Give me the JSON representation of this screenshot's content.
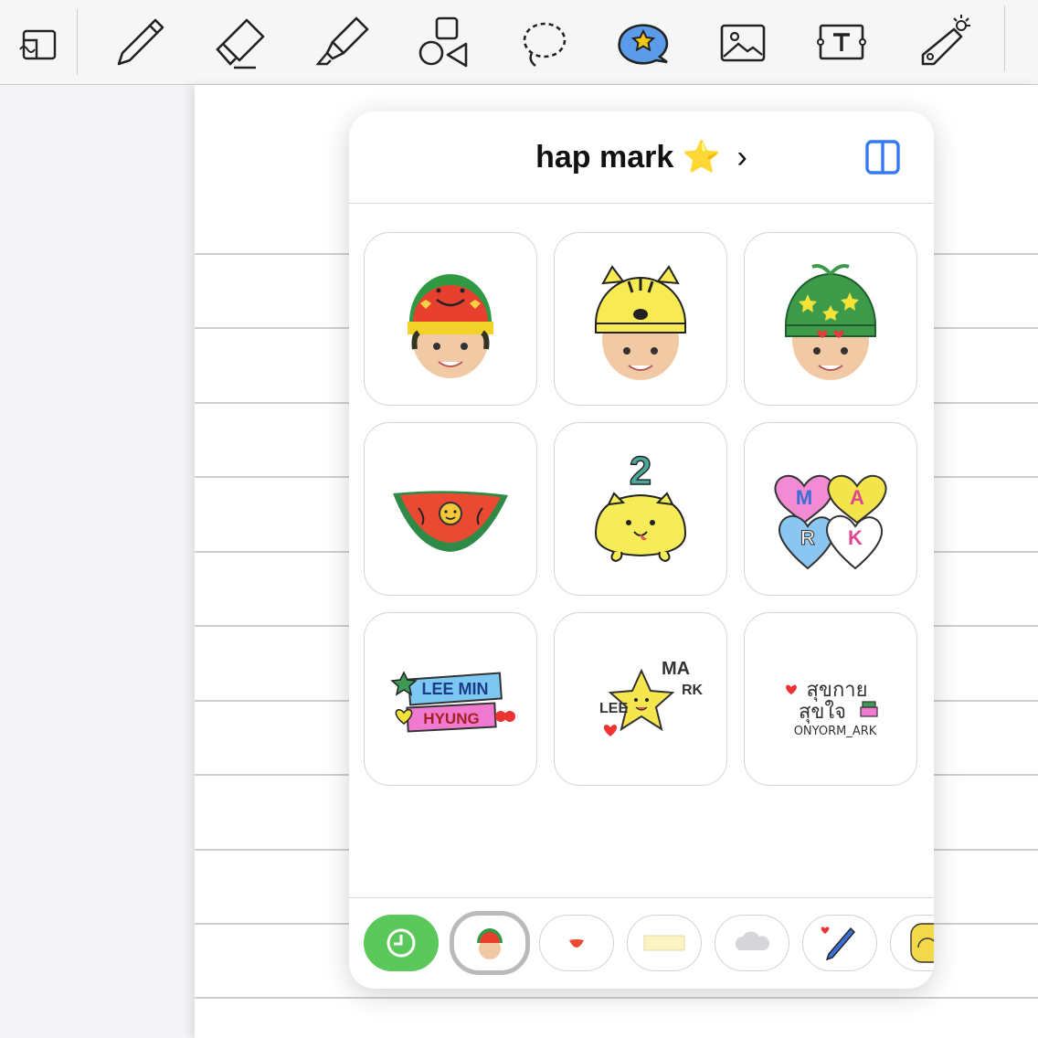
{
  "toolbar": {
    "tools": [
      {
        "name": "page-layout-icon"
      },
      {
        "name": "pen-icon"
      },
      {
        "name": "eraser-icon"
      },
      {
        "name": "highlighter-icon"
      },
      {
        "name": "shapes-icon"
      },
      {
        "name": "lasso-icon"
      },
      {
        "name": "sticker-icon",
        "active": true
      },
      {
        "name": "image-icon"
      },
      {
        "name": "text-icon"
      },
      {
        "name": "laser-pointer-icon"
      }
    ],
    "accent_color": "#5b9bea"
  },
  "popover": {
    "title": "hap mark",
    "title_emoji": "⭐",
    "chevron": "›",
    "stickers": [
      {
        "name": "sticker-watermelon-hat-boy"
      },
      {
        "name": "sticker-tiger-hat-boy"
      },
      {
        "name": "sticker-star-hat-boy"
      },
      {
        "name": "sticker-watermelon-slice"
      },
      {
        "name": "sticker-tiger-number-2",
        "text": "2"
      },
      {
        "name": "sticker-mark-hearts",
        "letters": [
          "M",
          "A",
          "R",
          "K"
        ]
      },
      {
        "name": "sticker-lee-min-hyung",
        "line1": "LEE MIN",
        "line2": "HYUNG"
      },
      {
        "name": "sticker-lee-mark-star",
        "left": "LEE",
        "right1": "MA",
        "right2": "RK"
      },
      {
        "name": "sticker-thai-text",
        "line1": "สุขกาย",
        "line2": "สุขใจ",
        "line3": "ONYORM_ARK"
      }
    ],
    "packs": [
      {
        "name": "recent-pack",
        "icon": "clock-icon"
      },
      {
        "name": "pack-boy-face",
        "selected": true
      },
      {
        "name": "pack-watermelon"
      },
      {
        "name": "pack-paper-note"
      },
      {
        "name": "pack-cloud"
      },
      {
        "name": "pack-pen"
      },
      {
        "name": "pack-thanks-badge"
      }
    ]
  }
}
